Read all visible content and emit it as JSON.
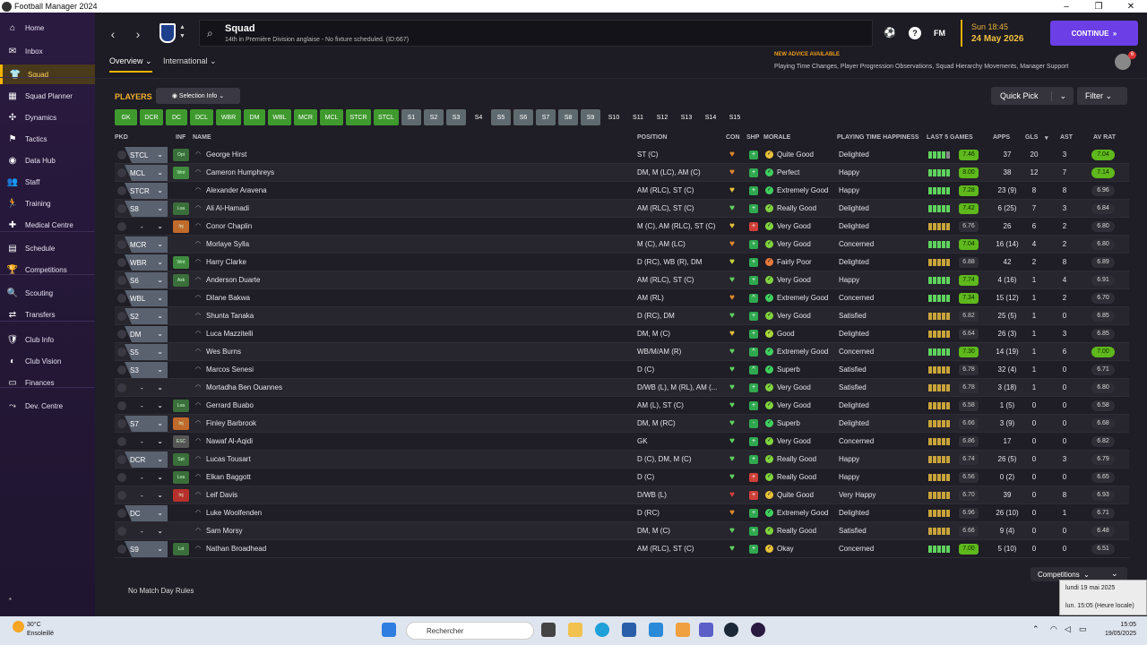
{
  "window": {
    "title": "Football Manager 2024",
    "controls": [
      "–",
      "❐",
      "✕"
    ]
  },
  "sidebar": {
    "items": [
      {
        "label": "Home",
        "icon": "home-icon",
        "glyph": "⌂"
      },
      {
        "label": "Inbox",
        "icon": "inbox-icon",
        "glyph": "✉"
      },
      {
        "label": "Squad",
        "icon": "shirt-icon",
        "glyph": "👕",
        "active": true
      },
      {
        "label": "Squad Planner",
        "icon": "planner-icon",
        "glyph": "▦"
      },
      {
        "label": "Dynamics",
        "icon": "dynamics-icon",
        "glyph": "✣"
      },
      {
        "label": "Tactics",
        "icon": "tactics-icon",
        "glyph": "⚑"
      },
      {
        "label": "Data Hub",
        "icon": "data-hub-icon",
        "glyph": "◉"
      },
      {
        "label": "Staff",
        "icon": "staff-icon",
        "glyph": "👥"
      },
      {
        "label": "Training",
        "icon": "training-icon",
        "glyph": "🏃"
      },
      {
        "label": "Medical Centre",
        "icon": "medical-icon",
        "glyph": "✚"
      },
      {
        "label": "Schedule",
        "icon": "schedule-icon",
        "glyph": "▤"
      },
      {
        "label": "Competitions",
        "icon": "trophy-icon",
        "glyph": "🏆"
      },
      {
        "label": "Scouting",
        "icon": "scouting-icon",
        "glyph": "🔍"
      },
      {
        "label": "Transfers",
        "icon": "transfers-icon",
        "glyph": "⇄"
      },
      {
        "label": "Club Info",
        "icon": "club-info-icon",
        "glyph": "🛡"
      },
      {
        "label": "Club Vision",
        "icon": "vision-icon",
        "glyph": "◐"
      },
      {
        "label": "Finances",
        "icon": "finances-icon",
        "glyph": "▭"
      },
      {
        "label": "Dev. Centre",
        "icon": "dev-centre-icon",
        "glyph": "⤳"
      }
    ]
  },
  "header": {
    "title": "Squad",
    "subtitle": "14th in Première Division anglaise - No fixture scheduled. (ID:667)",
    "date_day": "Sun 18:45",
    "date": "24 May 2026",
    "continue_label": "CONTINUE",
    "fm_label": "FM",
    "help": "?"
  },
  "subnav": {
    "tabs": [
      "Overview",
      "International"
    ],
    "advice_title": "NEW ADVICE AVAILABLE",
    "advice_text": "Playing Time Changes, Player Progression Observations, Squad Hierarchy Movements, Manager Support",
    "badge_count": "6"
  },
  "toolbar": {
    "players_label": "PLAYERS",
    "selection_info": "Selection Info",
    "quick_pick": "Quick Pick",
    "filter": "Filter"
  },
  "position_chips": [
    {
      "label": "GK",
      "style": "g"
    },
    {
      "label": "DCR",
      "style": "g"
    },
    {
      "label": "DC",
      "style": "g"
    },
    {
      "label": "DCL",
      "style": "g"
    },
    {
      "label": "WBR",
      "style": "g"
    },
    {
      "label": "DM",
      "style": "g"
    },
    {
      "label": "WBL",
      "style": "g"
    },
    {
      "label": "MCR",
      "style": "g"
    },
    {
      "label": "MCL",
      "style": "g"
    },
    {
      "label": "STCR",
      "style": "g"
    },
    {
      "label": "STCL",
      "style": "g"
    },
    {
      "label": "S1",
      "style": "s"
    },
    {
      "label": "S2",
      "style": "s"
    },
    {
      "label": "S3",
      "style": "s"
    },
    {
      "label": "S4",
      "style": "p"
    },
    {
      "label": "S5",
      "style": "s"
    },
    {
      "label": "S6",
      "style": "s"
    },
    {
      "label": "S7",
      "style": "s"
    },
    {
      "label": "S8",
      "style": "s"
    },
    {
      "label": "S9",
      "style": "s"
    },
    {
      "label": "S10",
      "style": "p"
    },
    {
      "label": "S11",
      "style": "p"
    },
    {
      "label": "S12",
      "style": "p"
    },
    {
      "label": "S13",
      "style": "p"
    },
    {
      "label": "S14",
      "style": "p"
    },
    {
      "label": "S15",
      "style": "p"
    }
  ],
  "columns": [
    "PKD",
    "INF",
    "NAME",
    "POSITION",
    "CON",
    "SHP",
    "MORALE",
    "PLAYING TIME HAPPINESS",
    "LAST 5 GAMES",
    "APPS",
    "GLS",
    "AST",
    "AV RAT"
  ],
  "players": [
    {
      "role": "STCL",
      "inf": "Opt",
      "inf_color": "#3a6e3a",
      "name": "George Hirst",
      "position": "ST (C)",
      "con": "#e08a2c",
      "shp": "#2fa84f",
      "shp_glyph": "+",
      "morale_color": "#e8c23a",
      "morale": "Quite Good",
      "pth": "Delighted",
      "form": [
        "#5fd35f",
        "#5fd35f",
        "#5fd35f",
        "#5fd35f",
        "#888"
      ],
      "last5": "7.46",
      "last5_hi": true,
      "apps": "37",
      "gls": "20",
      "ast": "3",
      "avrat": "7.04",
      "avrat_hi": true
    },
    {
      "role": "MCL",
      "inf": "Wnt",
      "inf_color": "#3f8a3f",
      "name": "Cameron Humphreys",
      "position": "DM, M (LC), AM (C)",
      "con": "#e08a2c",
      "shp": "#2fa84f",
      "shp_glyph": "+",
      "morale_color": "#3fcf5f",
      "morale": "Perfect",
      "pth": "Happy",
      "form": [
        "#5fd35f",
        "#5fd35f",
        "#5fd35f",
        "#5fd35f",
        "#5fd35f"
      ],
      "last5": "8.00",
      "last5_hi": true,
      "apps": "38",
      "gls": "12",
      "ast": "7",
      "avrat": "7.14",
      "avrat_hi": true
    },
    {
      "role": "STCR",
      "inf": "",
      "inf_color": "",
      "name": "Alexander Aravena",
      "position": "AM (RLC), ST (C)",
      "con": "#e8c23a",
      "shp": "#2fa84f",
      "shp_glyph": "+",
      "morale_color": "#3fcf5f",
      "morale": "Extremely Good",
      "pth": "Happy",
      "form": [
        "#5fd35f",
        "#5fd35f",
        "#5fd35f",
        "#5fd35f",
        "#5fd35f"
      ],
      "last5": "7.28",
      "last5_hi": true,
      "apps": "23 (9)",
      "gls": "8",
      "ast": "8",
      "avrat": "6.96",
      "avrat_hi": false
    },
    {
      "role": "S8",
      "inf": "Loa",
      "inf_color": "#3a6e3a",
      "name": "Ali Al-Hamadi",
      "position": "AM (RLC), ST (C)",
      "con": "#5fd35f",
      "shp": "#2fa84f",
      "shp_glyph": "+",
      "morale_color": "#7fd33f",
      "morale": "Really Good",
      "pth": "Delighted",
      "form": [
        "#5fd35f",
        "#5fd35f",
        "#5fd35f",
        "#5fd35f",
        "#5fd35f"
      ],
      "last5": "7.42",
      "last5_hi": true,
      "apps": "6 (25)",
      "gls": "7",
      "ast": "3",
      "avrat": "6.84",
      "avrat_hi": false
    },
    {
      "role": "-",
      "inf": "Inj",
      "inf_color": "#c06a2c",
      "name": "Conor Chaplin",
      "position": "M (C), AM (RLC), ST (C)",
      "con": "#e8c23a",
      "shp": "#d0403a",
      "shp_glyph": "+",
      "morale_color": "#7fd33f",
      "morale": "Very Good",
      "pth": "Delighted",
      "form": [
        "#c9a43a",
        "#c9a43a",
        "#c9a43a",
        "#c9a43a",
        "#c9a43a"
      ],
      "last5": "6.76",
      "last5_hi": false,
      "apps": "26",
      "gls": "6",
      "ast": "2",
      "avrat": "6.80",
      "avrat_hi": false
    },
    {
      "role": "MCR",
      "inf": "",
      "inf_color": "",
      "name": "Morlaye Sylla",
      "position": "M (C), AM (LC)",
      "con": "#e08a2c",
      "shp": "#2fa84f",
      "shp_glyph": "+",
      "morale_color": "#7fd33f",
      "morale": "Very Good",
      "pth": "Concerned",
      "form": [
        "#5fd35f",
        "#5fd35f",
        "#5fd35f",
        "#5fd35f",
        "#5fd35f"
      ],
      "last5": "7.04",
      "last5_hi": true,
      "apps": "16 (14)",
      "gls": "4",
      "ast": "2",
      "avrat": "6.80",
      "avrat_hi": false
    },
    {
      "role": "WBR",
      "inf": "Wnt",
      "inf_color": "#3f8a3f",
      "name": "Harry Clarke",
      "position": "D (RC), WB (R), DM",
      "con": "#c8d83a",
      "shp": "#2fa84f",
      "shp_glyph": "+",
      "morale_color": "#e87a3a",
      "morale": "Fairly Poor",
      "pth": "Delighted",
      "form": [
        "#c9a43a",
        "#c9a43a",
        "#c9a43a",
        "#c9a43a",
        "#c9a43a"
      ],
      "last5": "6.88",
      "last5_hi": false,
      "apps": "42",
      "gls": "2",
      "ast": "8",
      "avrat": "6.89",
      "avrat_hi": false
    },
    {
      "role": "S6",
      "inf": "Ask",
      "inf_color": "#3a6e3a",
      "name": "Anderson Duarte",
      "position": "AM (RLC), ST (C)",
      "con": "#5fd35f",
      "shp": "#2fa84f",
      "shp_glyph": "+",
      "morale_color": "#7fd33f",
      "morale": "Very Good",
      "pth": "Happy",
      "form": [
        "#5fd35f",
        "#5fd35f",
        "#5fd35f",
        "#5fd35f",
        "#5fd35f"
      ],
      "last5": "7.74",
      "last5_hi": true,
      "apps": "4 (16)",
      "gls": "1",
      "ast": "4",
      "avrat": "6.91",
      "avrat_hi": false
    },
    {
      "role": "WBL",
      "inf": "",
      "inf_color": "",
      "name": "Dilane Bakwa",
      "position": "AM (RL)",
      "con": "#e08a2c",
      "shp": "#2fa84f",
      "shp_glyph": "^",
      "morale_color": "#3fcf5f",
      "morale": "Extremely Good",
      "pth": "Concerned",
      "form": [
        "#5fd35f",
        "#5fd35f",
        "#5fd35f",
        "#5fd35f",
        "#5fd35f"
      ],
      "last5": "7.34",
      "last5_hi": true,
      "apps": "15 (12)",
      "gls": "1",
      "ast": "2",
      "avrat": "6.70",
      "avrat_hi": false
    },
    {
      "role": "S2",
      "inf": "",
      "inf_color": "",
      "name": "Shunta Tanaka",
      "position": "D (RC), DM",
      "con": "#5fd35f",
      "shp": "#2fa84f",
      "shp_glyph": "+",
      "morale_color": "#7fd33f",
      "morale": "Very Good",
      "pth": "Satisfied",
      "form": [
        "#c9a43a",
        "#c9a43a",
        "#c9a43a",
        "#c9a43a",
        "#c9a43a"
      ],
      "last5": "6.82",
      "last5_hi": false,
      "apps": "25 (5)",
      "gls": "1",
      "ast": "0",
      "avrat": "6.85",
      "avrat_hi": false
    },
    {
      "role": "DM",
      "inf": "",
      "inf_color": "",
      "name": "Luca Mazzitelli",
      "position": "DM, M (C)",
      "con": "#e8c23a",
      "shp": "#2fa84f",
      "shp_glyph": "+",
      "morale_color": "#a8d83a",
      "morale": "Good",
      "pth": "Delighted",
      "form": [
        "#c9a43a",
        "#c9a43a",
        "#c9a43a",
        "#c9a43a",
        "#c9a43a"
      ],
      "last5": "6.64",
      "last5_hi": false,
      "apps": "26 (3)",
      "gls": "1",
      "ast": "3",
      "avrat": "6.85",
      "avrat_hi": false
    },
    {
      "role": "S5",
      "inf": "",
      "inf_color": "",
      "name": "Wes Burns",
      "position": "WB/M/AM (R)",
      "con": "#5fd35f",
      "shp": "#2fa84f",
      "shp_glyph": "^",
      "morale_color": "#3fcf5f",
      "morale": "Extremely Good",
      "pth": "Concerned",
      "form": [
        "#5fd35f",
        "#5fd35f",
        "#5fd35f",
        "#5fd35f",
        "#5fd35f"
      ],
      "last5": "7.30",
      "last5_hi": true,
      "apps": "14 (19)",
      "gls": "1",
      "ast": "6",
      "avrat": "7.00",
      "avrat_hi": true
    },
    {
      "role": "S3",
      "inf": "",
      "inf_color": "",
      "name": "Marcos Senesi",
      "position": "D (C)",
      "con": "#5fd35f",
      "shp": "#2fa84f",
      "shp_glyph": "^",
      "morale_color": "#3fcf5f",
      "morale": "Superb",
      "pth": "Satisfied",
      "form": [
        "#c9a43a",
        "#c9a43a",
        "#c9a43a",
        "#c9a43a",
        "#c9a43a"
      ],
      "last5": "6.78",
      "last5_hi": false,
      "apps": "32 (4)",
      "gls": "1",
      "ast": "0",
      "avrat": "6.71",
      "avrat_hi": false
    },
    {
      "role": "-",
      "inf": "",
      "inf_color": "",
      "name": "Mortadha Ben Ouannes",
      "position": "D/WB (L), M (RL), AM (...",
      "con": "#5fd35f",
      "shp": "#2fa84f",
      "shp_glyph": "+",
      "morale_color": "#7fd33f",
      "morale": "Very Good",
      "pth": "Satisfied",
      "form": [
        "#c9a43a",
        "#c9a43a",
        "#c9a43a",
        "#c9a43a",
        "#c9a43a"
      ],
      "last5": "6.78",
      "last5_hi": false,
      "apps": "3 (18)",
      "gls": "1",
      "ast": "0",
      "avrat": "6.80",
      "avrat_hi": false
    },
    {
      "role": "-",
      "inf": "Loa",
      "inf_color": "#3a6e3a",
      "name": "Gerrard Buabo",
      "position": "AM (L), ST (C)",
      "con": "#5fd35f",
      "shp": "#2fa84f",
      "shp_glyph": "+",
      "morale_color": "#7fd33f",
      "morale": "Very Good",
      "pth": "Delighted",
      "form": [
        "#c9a43a",
        "#c9a43a",
        "#c9a43a",
        "#c9a43a",
        "#c9a43a"
      ],
      "last5": "6.58",
      "last5_hi": false,
      "apps": "1 (5)",
      "gls": "0",
      "ast": "0",
      "avrat": "6.58",
      "avrat_hi": false
    },
    {
      "role": "S7",
      "inf": "Inj",
      "inf_color": "#c06a2c",
      "name": "Finley Barbrook",
      "position": "DM, M (RC)",
      "con": "#5fd35f",
      "shp": "#2fa84f",
      "shp_glyph": "-",
      "morale_color": "#3fcf5f",
      "morale": "Superb",
      "pth": "Delighted",
      "form": [
        "#c9a43a",
        "#c9a43a",
        "#c9a43a",
        "#c9a43a",
        "#c9a43a"
      ],
      "last5": "6.66",
      "last5_hi": false,
      "apps": "3 (9)",
      "gls": "0",
      "ast": "0",
      "avrat": "6.68",
      "avrat_hi": false
    },
    {
      "role": "-",
      "inf": "ESC",
      "inf_color": "#555",
      "name": "Nawaf Al-Aqidi",
      "position": "GK",
      "con": "#5fd35f",
      "shp": "#2fa84f",
      "shp_glyph": "+",
      "morale_color": "#7fd33f",
      "morale": "Very Good",
      "pth": "Concerned",
      "form": [
        "#c9a43a",
        "#c9a43a",
        "#c9a43a",
        "#c9a43a",
        "#c9a43a"
      ],
      "last5": "6.86",
      "last5_hi": false,
      "apps": "17",
      "gls": "0",
      "ast": "0",
      "avrat": "6.82",
      "avrat_hi": false
    },
    {
      "role": "DCR",
      "inf": "Spt",
      "inf_color": "#3a6e3a",
      "name": "Lucas Tousart",
      "position": "D (C), DM, M (C)",
      "con": "#5fd35f",
      "shp": "#2fa84f",
      "shp_glyph": "+",
      "morale_color": "#7fd33f",
      "morale": "Really Good",
      "pth": "Happy",
      "form": [
        "#c9a43a",
        "#c9a43a",
        "#c9a43a",
        "#c9a43a",
        "#c9a43a"
      ],
      "last5": "6.74",
      "last5_hi": false,
      "apps": "26 (5)",
      "gls": "0",
      "ast": "3",
      "avrat": "6.79",
      "avrat_hi": false
    },
    {
      "role": "-",
      "inf": "Loa",
      "inf_color": "#3a6e3a",
      "name": "Elkan Baggott",
      "position": "D (C)",
      "con": "#5fd35f",
      "shp": "#d0403a",
      "shp_glyph": "+",
      "morale_color": "#7fd33f",
      "morale": "Really Good",
      "pth": "Happy",
      "form": [
        "#c9a43a",
        "#c9a43a",
        "#c9a43a",
        "#c9a43a",
        "#c9a43a"
      ],
      "last5": "6.56",
      "last5_hi": false,
      "apps": "0 (2)",
      "gls": "0",
      "ast": "0",
      "avrat": "6.65",
      "avrat_hi": false
    },
    {
      "role": "-",
      "inf": "Inj",
      "inf_color": "#b8302c",
      "name": "Leif Davis",
      "position": "D/WB (L)",
      "con": "#d0403a",
      "shp": "#d0403a",
      "shp_glyph": "+",
      "morale_color": "#e8c23a",
      "morale": "Quite Good",
      "pth": "Very Happy",
      "form": [
        "#c9a43a",
        "#c9a43a",
        "#c9a43a",
        "#c9a43a",
        "#c9a43a"
      ],
      "last5": "6.70",
      "last5_hi": false,
      "apps": "39",
      "gls": "0",
      "ast": "8",
      "avrat": "6.93",
      "avrat_hi": false
    },
    {
      "role": "DC",
      "inf": "",
      "inf_color": "",
      "name": "Luke Woolfenden",
      "position": "D (RC)",
      "con": "#e08a2c",
      "shp": "#2fa84f",
      "shp_glyph": "+",
      "morale_color": "#3fcf5f",
      "morale": "Extremely Good",
      "pth": "Delighted",
      "form": [
        "#c9a43a",
        "#c9a43a",
        "#c9a43a",
        "#c9a43a",
        "#c9a43a"
      ],
      "last5": "6.96",
      "last5_hi": false,
      "apps": "26 (10)",
      "gls": "0",
      "ast": "1",
      "avrat": "6.71",
      "avrat_hi": false
    },
    {
      "role": "-",
      "inf": "",
      "inf_color": "",
      "name": "Sam Morsy",
      "position": "DM, M (C)",
      "con": "#5fd35f",
      "shp": "#2fa84f",
      "shp_glyph": "+",
      "morale_color": "#7fd33f",
      "morale": "Really Good",
      "pth": "Satisfied",
      "form": [
        "#c9a43a",
        "#c9a43a",
        "#c9a43a",
        "#c9a43a",
        "#c9a43a"
      ],
      "last5": "6.66",
      "last5_hi": false,
      "apps": "9 (4)",
      "gls": "0",
      "ast": "0",
      "avrat": "6.48",
      "avrat_hi": false
    },
    {
      "role": "S9",
      "inf": "Lst",
      "inf_color": "#3a6e3a",
      "name": "Nathan Broadhead",
      "position": "AM (RLC), ST (C)",
      "con": "#5fd35f",
      "shp": "#2fa84f",
      "shp_glyph": "+",
      "morale_color": "#e8c23a",
      "morale": "Okay",
      "pth": "Concerned",
      "form": [
        "#5fd35f",
        "#5fd35f",
        "#5fd35f",
        "#5fd35f",
        "#5fd35f"
      ],
      "last5": "7.00",
      "last5_hi": true,
      "apps": "5 (10)",
      "gls": "0",
      "ast": "0",
      "avrat": "6.51",
      "avrat_hi": false
    }
  ],
  "footer": {
    "competitions": "Competitions",
    "no_match": "No Match Day Rules"
  },
  "tooltip": {
    "line1": "lundi 19 mai 2025",
    "line2": "lun. 15:05 (Heure locale)"
  },
  "taskbar": {
    "temp": "30°C",
    "weather": "Ensoleillé",
    "search_placeholder": "Rechercher",
    "time": "15:05",
    "date": "19/05/2025"
  }
}
